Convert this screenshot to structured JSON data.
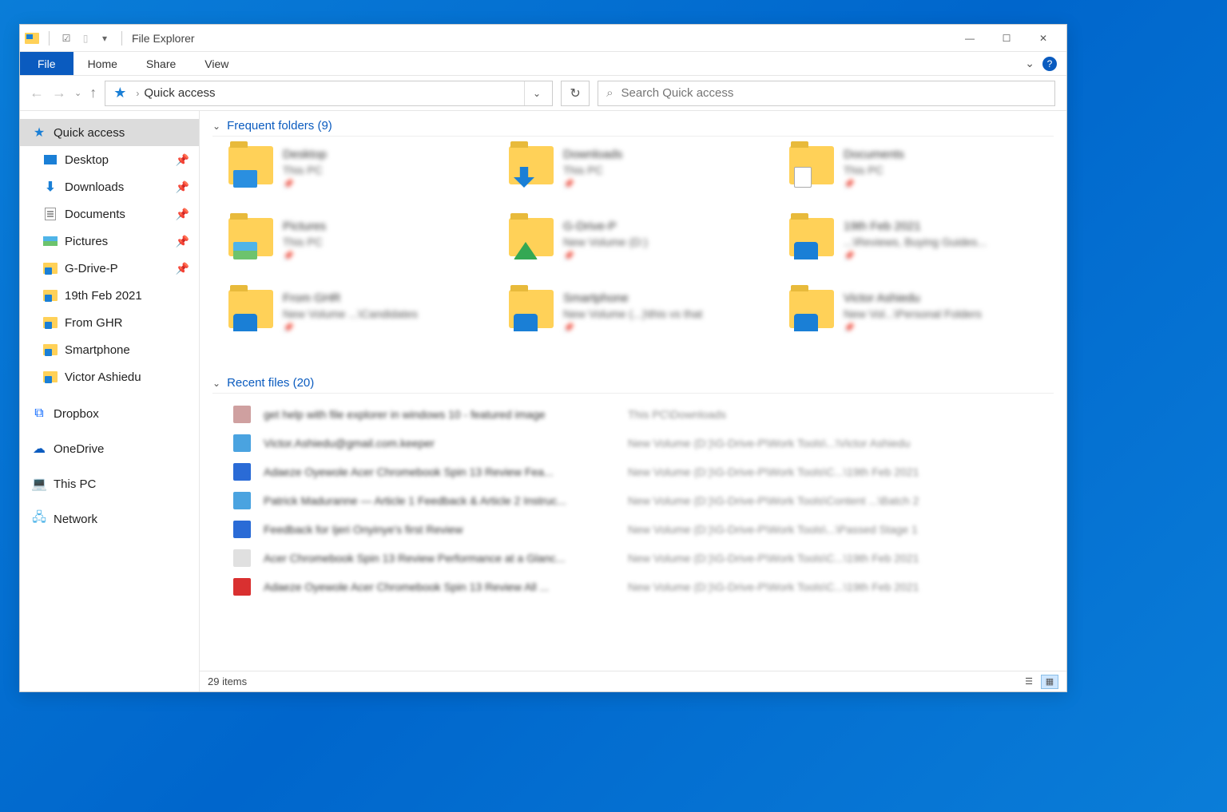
{
  "window": {
    "title": "File Explorer"
  },
  "ribbon": {
    "file": "File",
    "tabs": [
      "Home",
      "Share",
      "View"
    ]
  },
  "address": {
    "breadcrumb": "Quick access",
    "search_placeholder": "Search Quick access"
  },
  "sidebar": {
    "quick_access": "Quick access",
    "items": [
      {
        "label": "Desktop",
        "icon": "desktop",
        "pinned": true
      },
      {
        "label": "Downloads",
        "icon": "download",
        "pinned": true
      },
      {
        "label": "Documents",
        "icon": "document",
        "pinned": true
      },
      {
        "label": "Pictures",
        "icon": "pictures",
        "pinned": true
      },
      {
        "label": "G-Drive-P",
        "icon": "folder-mark",
        "pinned": true
      },
      {
        "label": "19th Feb 2021",
        "icon": "folder-mark",
        "pinned": false
      },
      {
        "label": "From GHR",
        "icon": "folder-mark",
        "pinned": false
      },
      {
        "label": "Smartphone",
        "icon": "folder-mark",
        "pinned": false
      },
      {
        "label": "Victor Ashiedu",
        "icon": "folder-mark",
        "pinned": false
      }
    ],
    "roots": [
      {
        "label": "Dropbox",
        "icon": "dropbox"
      },
      {
        "label": "OneDrive",
        "icon": "onedrive"
      },
      {
        "label": "This PC",
        "icon": "thispc"
      },
      {
        "label": "Network",
        "icon": "network"
      }
    ]
  },
  "groups": {
    "frequent_label": "Frequent folders (9)",
    "recent_label": "Recent files (20)"
  },
  "frequent": [
    {
      "name": "Desktop",
      "sub": "This PC",
      "overlay": "screen"
    },
    {
      "name": "Downloads",
      "sub": "This PC",
      "overlay": "arrow"
    },
    {
      "name": "Documents",
      "sub": "This PC",
      "overlay": "doc"
    },
    {
      "name": "Pictures",
      "sub": "This PC",
      "overlay": "pic"
    },
    {
      "name": "G-Drive-P",
      "sub": "New Volume (D:)",
      "overlay": "gd"
    },
    {
      "name": "19th Feb 2021",
      "sub": "...\\Reviews, Buying Guides...",
      "overlay": "person"
    },
    {
      "name": "From GHR",
      "sub": "New Volume ...\\Candidates",
      "overlay": "person"
    },
    {
      "name": "Smartphone",
      "sub": "New Volume (...)\\this vs that",
      "overlay": "person"
    },
    {
      "name": "Victor Ashiedu",
      "sub": "New Vol...\\Personal Folders",
      "overlay": "person"
    }
  ],
  "recent": [
    {
      "name": "get help with file explorer in windows 10 - featured image",
      "path": "This PC\\Downloads",
      "color": "#cfa0a0"
    },
    {
      "name": "Victor.Ashiedu@gmail.com.keeper",
      "path": "New Volume (D:)\\G-Drive-P\\Work Tools\\...\\Victor Ashiedu",
      "color": "#4aa3e0"
    },
    {
      "name": "Adaeze Oyewole Acer Chromebook Spin 13 Review Fea...",
      "path": "New Volume (D:)\\G-Drive-P\\Work Tools\\C...\\19th Feb 2021",
      "color": "#2a6bd6"
    },
    {
      "name": "Patrick Maduranne — Article 1 Feedback & Article 2 Instruc...",
      "path": "New Volume (D:)\\G-Drive-P\\Work Tools\\Content ...\\Batch 2",
      "color": "#4aa3e0"
    },
    {
      "name": "Feedback for Ijeri Onyinye's first Review",
      "path": "New Volume (D:)\\G-Drive-P\\Work Tools\\...\\Passed Stage 1",
      "color": "#2a6bd6"
    },
    {
      "name": "Acer Chromebook Spin 13 Review Performance at a Glanc...",
      "path": "New Volume (D:)\\G-Drive-P\\Work Tools\\C...\\19th Feb 2021",
      "color": "#e0e0e0"
    },
    {
      "name": "Adaeze Oyewole Acer Chromebook Spin 13 Review  All ...",
      "path": "New Volume (D:)\\G-Drive-P\\Work Tools\\C...\\19th Feb 2021",
      "color": "#d93030"
    }
  ],
  "statusbar": {
    "count": "29 items"
  }
}
